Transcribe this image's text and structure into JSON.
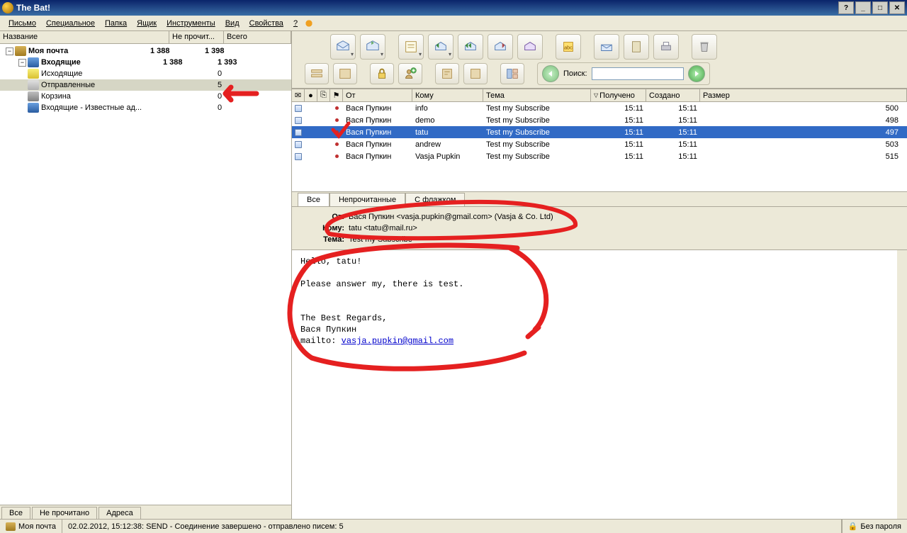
{
  "window": {
    "title": "The Bat!"
  },
  "menu": {
    "items": [
      "Письмо",
      "Специальное",
      "Папка",
      "Ящик",
      "Инструменты",
      "Вид",
      "Свойства",
      "?"
    ]
  },
  "tree": {
    "headers": [
      "Название",
      "Не прочит...",
      "Всего"
    ],
    "rows": [
      {
        "label": "Моя почта",
        "unread": "1 388",
        "total": "1 398",
        "level": 0,
        "expandable": true,
        "bold": true,
        "icon": "ficon-mail"
      },
      {
        "label": "Входящие",
        "unread": "1 388",
        "total": "1 393",
        "level": 1,
        "expandable": true,
        "bold": true,
        "icon": "ficon-in"
      },
      {
        "label": "Исходящие",
        "unread": "",
        "total": "0",
        "level": 1,
        "icon": "ficon-out"
      },
      {
        "label": "Отправленные",
        "unread": "",
        "total": "5",
        "level": 1,
        "icon": "ficon-sent",
        "selected": true
      },
      {
        "label": "Корзина",
        "unread": "",
        "total": "0",
        "level": 1,
        "icon": "ficon-trash"
      },
      {
        "label": "Входящие - Известные ад...",
        "unread": "",
        "total": "0",
        "level": 1,
        "icon": "ficon-in"
      }
    ]
  },
  "leftTabs": [
    "Все",
    "Не прочитано",
    "Адреса"
  ],
  "search": {
    "label": "Поиск:",
    "value": ""
  },
  "msgHeaders": {
    "from": "От",
    "to": "Кому",
    "subject": "Тема",
    "received": "Получено",
    "created": "Создано",
    "size": "Размер"
  },
  "messages": [
    {
      "from": "Вася Пупкин",
      "to": "info",
      "subject": "Test my Subscribe",
      "received": "15:11",
      "created": "15:11",
      "size": "500"
    },
    {
      "from": "Вася Пупкин",
      "to": "demo",
      "subject": "Test my Subscribe",
      "received": "15:11",
      "created": "15:11",
      "size": "498"
    },
    {
      "from": "Вася Пупкин",
      "to": "tatu",
      "subject": "Test my Subscribe",
      "received": "15:11",
      "created": "15:11",
      "size": "497",
      "selected": true
    },
    {
      "from": "Вася Пупкин",
      "to": "andrew",
      "subject": "Test my Subscribe",
      "received": "15:11",
      "created": "15:11",
      "size": "503"
    },
    {
      "from": "Вася Пупкин",
      "to": "Vasja Pupkin",
      "subject": "Test my Subscribe",
      "received": "15:11",
      "created": "15:11",
      "size": "515"
    }
  ],
  "filterTabs": [
    "Все",
    "Непрочитанные",
    "С флажком"
  ],
  "preview": {
    "headers": {
      "fromLabel": "От:",
      "fromValue": "Вася Пупкин <vasja.pupkin@gmail.com>  (Vasja & Co. Ltd)",
      "toLabel": "Кому:",
      "toValue": "tatu <tatu@mail.ru>",
      "subjLabel": "Тема:",
      "subjValue": "Test my Subscribe"
    },
    "body": {
      "l1": "Hello, tatu!",
      "l2": "Please answer my, there is test.",
      "l3": "The Best Regards,",
      "l4": "Вася Пупкин",
      "l5": "mailto:",
      "link": "vasja.pupkin@gmail.com"
    }
  },
  "status": {
    "left": "Моя почта",
    "center": "02.02.2012, 15:12:38: SEND  - Соединение завершено - отправлено писем: 5",
    "right": "Без пароля"
  }
}
